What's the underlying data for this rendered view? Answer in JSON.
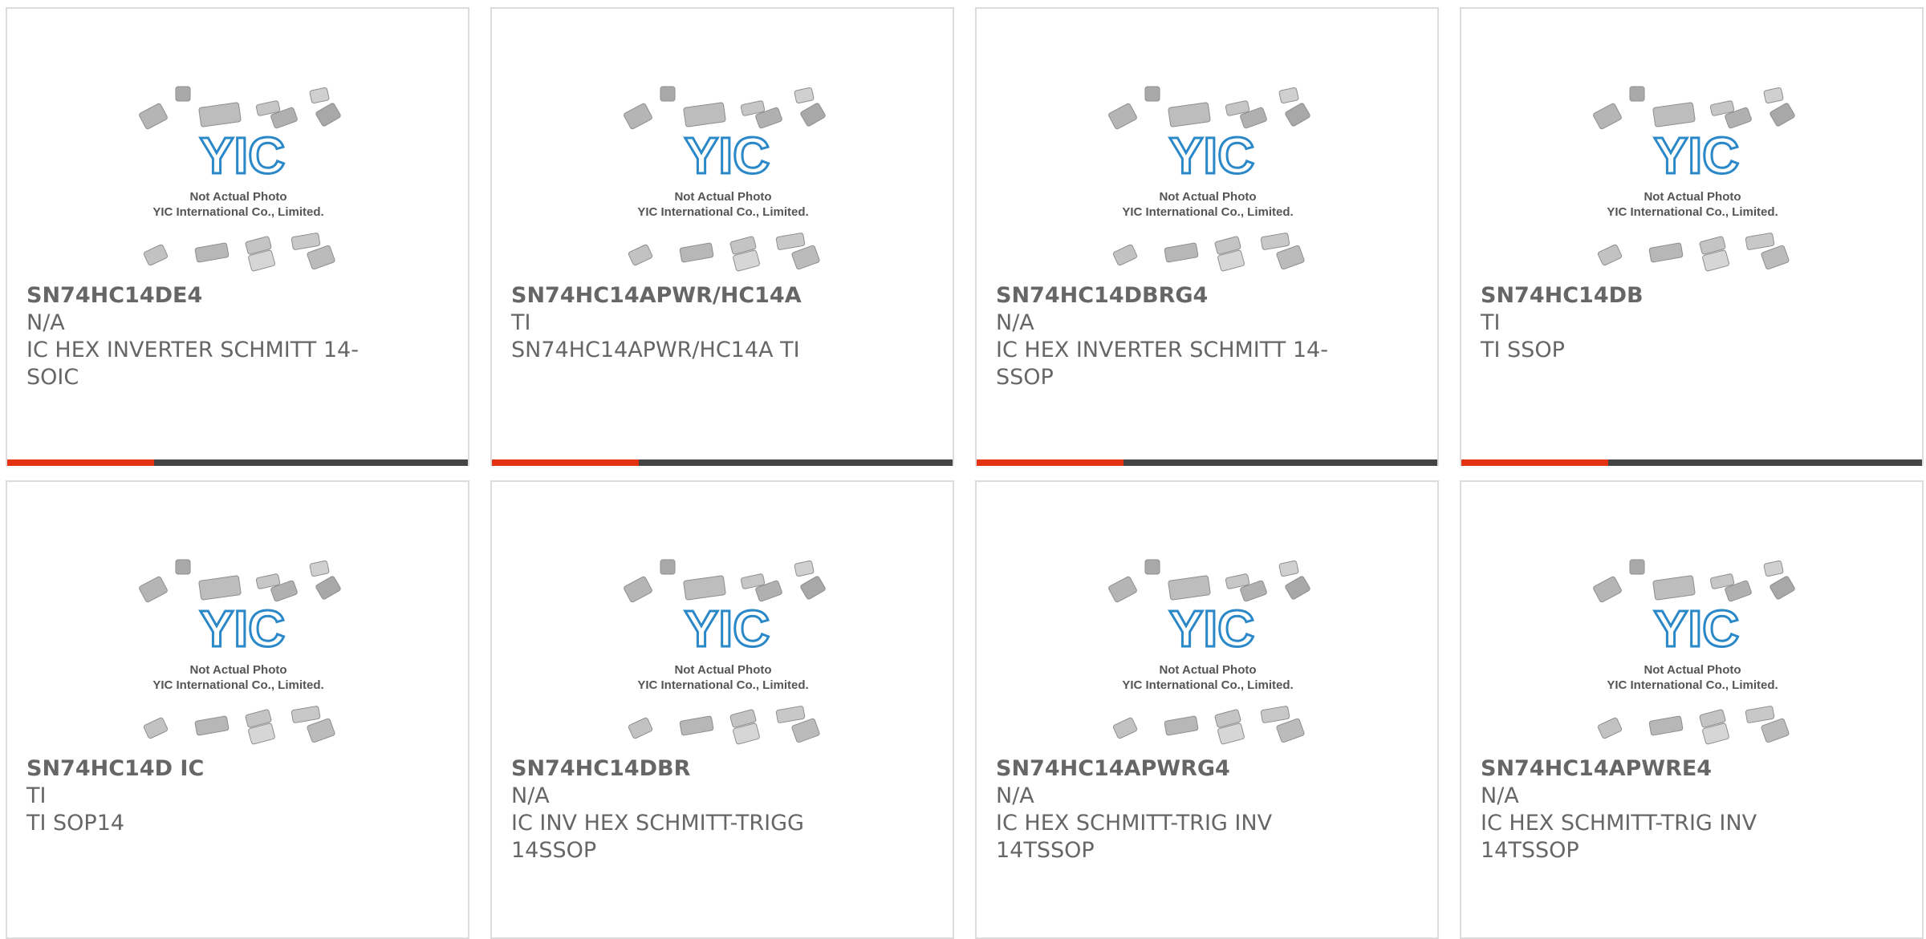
{
  "image_caption": {
    "line1": "Not Actual Photo",
    "line2": "YIC International Co., Limited.",
    "logo": "YIC"
  },
  "colors": {
    "accent": "#e53312",
    "bar": "#444444",
    "text": "#666666",
    "logo_blue": "#2a88c8"
  },
  "products": [
    {
      "part": "SN74HC14DE4",
      "mfr": "N/A",
      "desc": "IC HEX INVERTER SCHMITT 14-SOIC"
    },
    {
      "part": "SN74HC14APWR/HC14A",
      "mfr": "TI",
      "desc": "SN74HC14APWR/HC14A TI"
    },
    {
      "part": "SN74HC14DBRG4",
      "mfr": "N/A",
      "desc": "IC HEX INVERTER SCHMITT 14-SSOP"
    },
    {
      "part": "SN74HC14DB",
      "mfr": "TI",
      "desc": "TI SSOP"
    },
    {
      "part": "SN74HC14D IC",
      "mfr": "TI",
      "desc": "TI SOP14"
    },
    {
      "part": "SN74HC14DBR",
      "mfr": "N/A",
      "desc": "IC INV HEX SCHMITT-TRIGG 14SSOP"
    },
    {
      "part": "SN74HC14APWRG4",
      "mfr": "N/A",
      "desc": "IC HEX SCHMITT-TRIG INV 14TSSOP"
    },
    {
      "part": "SN74HC14APWRE4",
      "mfr": "N/A",
      "desc": "IC HEX SCHMITT-TRIG INV 14TSSOP"
    }
  ]
}
